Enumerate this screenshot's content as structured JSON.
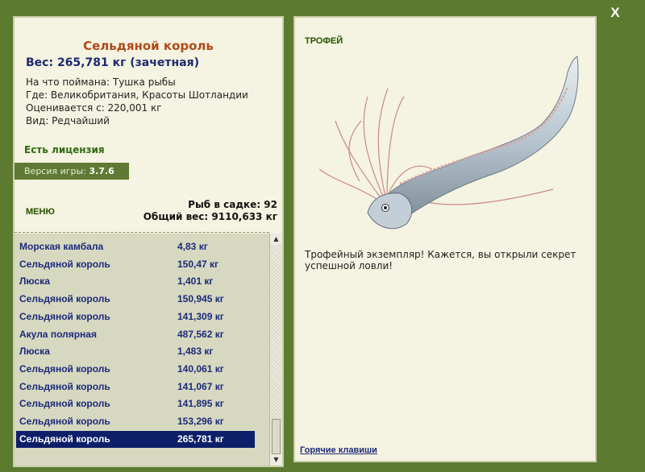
{
  "close_label": "X",
  "info": {
    "title": "Сельдяной король",
    "weight": "Вес: 265,781 кг (зачетная)",
    "bait": "На что поймана: Тушка рыбы",
    "location": "Где: Великобритания, Красоты Шотландии",
    "valued_from": "Оценивается с: 220,001 кг",
    "rarity": "Вид: Редчайший"
  },
  "license": "Есть лицензия",
  "version": {
    "label": "Версия игры:",
    "value": "3.7.6"
  },
  "menu_label": "МЕНЮ",
  "keepnet": {
    "count": "Рыб в садке: 92",
    "total": "Общий вес: 9110,633 кг"
  },
  "catches": [
    {
      "name": "Морская камбала",
      "weight": "4,83 кг"
    },
    {
      "name": "Сельдяной король",
      "weight": "150,47 кг"
    },
    {
      "name": "Люска",
      "weight": "1,401 кг"
    },
    {
      "name": "Сельдяной король",
      "weight": "150,945 кг"
    },
    {
      "name": "Сельдяной король",
      "weight": "141,309 кг"
    },
    {
      "name": "Акула полярная",
      "weight": "487,562 кг"
    },
    {
      "name": "Люска",
      "weight": "1,483 кг"
    },
    {
      "name": "Сельдяной король",
      "weight": "140,061 кг"
    },
    {
      "name": "Сельдяной король",
      "weight": "141,067 кг"
    },
    {
      "name": "Сельдяной король",
      "weight": "141,895 кг"
    },
    {
      "name": "Сельдяной король",
      "weight": "153,296 кг"
    },
    {
      "name": "Сельдяной король",
      "weight": "265,781 кг"
    }
  ],
  "selected_index": 11,
  "scroll_arrows": {
    "up": "▲",
    "down": "▼"
  },
  "trophy": {
    "label": "ТРОФЕЙ",
    "text": "Трофейный экземпляр! Кажется, вы открыли секрет успешной ловли!"
  },
  "hotkeys_label": "Горячие клавиши",
  "colors": {
    "frame_green": "#5c7a30",
    "panel_bg": "#f5f3e1",
    "title_orange": "#b04a1a",
    "navy": "#1c2a7a",
    "selected_row": "#0e1f6a"
  }
}
